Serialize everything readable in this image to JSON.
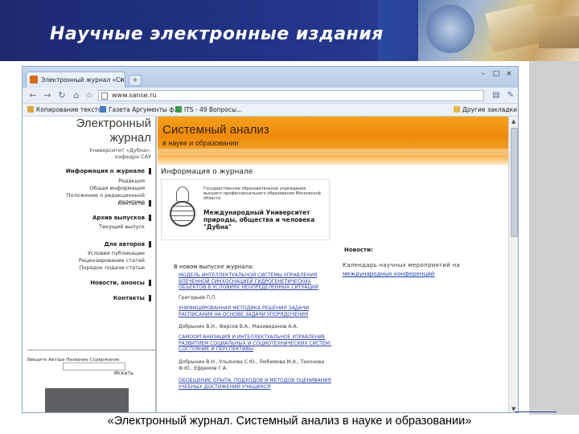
{
  "slide": {
    "title": "Научные электронные издания",
    "caption": "«Электронный журнал. Системный анализ в науке и образовании»"
  },
  "browser": {
    "tab_title": "Электронный журнал «Си...",
    "new_tab_label": "+",
    "window_buttons": [
      "–",
      "□",
      "×"
    ],
    "url": "www.sanse.ru",
    "nav": {
      "back": "←",
      "forward": "→",
      "reload": "↻"
    },
    "bookmarks": [
      {
        "label": "Копирование текстов",
        "color": "#d9a441"
      },
      {
        "label": "Газета Аргументы ф...",
        "color": "#4a79c4"
      },
      {
        "label": "ITS - 49 Вопросы...",
        "color": "#3a9a4a"
      }
    ],
    "other_bookmarks": "Другие закладки"
  },
  "page": {
    "logo_line1": "Электронный",
    "logo_line2": "журнал",
    "logo_sub": "Университет «Дубна», кафедра САУ",
    "banner_title": "Системный анализ",
    "banner_sub": "в науке и образовании",
    "sidebar": {
      "info_head": "Информация о журнале",
      "info_links": [
        "Редакция",
        "Общая информация",
        "Положение о редакционной политике",
        "Контакты"
      ],
      "archive_head": "Архив выпусков",
      "archive_links": [
        "Текущий выпуск"
      ],
      "authors_head": "Для авторов",
      "authors_links": [
        "Условия публикации",
        "Рецензирование статей",
        "Порядок подачи статьи"
      ],
      "news_head": "Новости, анонсы",
      "contacts_head": "Контакты"
    },
    "info_section_title": "Информация о журнале",
    "university_small": "Государственное образовательное учреждение высшего профессионального образования Московской области",
    "university_name": "Международный Университет природы, общества и человека \"Дубна\"",
    "news_head": "Новости:",
    "news_text": "Календарь научных мероприятий на",
    "news_link": "международных конференций",
    "issue_head": "В новом выпуске журнала:",
    "articles": [
      {
        "text": "МОДЕЛЬ ИНТЕЛЛЕКТУАЛЬНОЙ СИСТЕМЫ УПРАВЛЕНИЯ ВЛЕЧЕННОЙ СИНХОСНАЦИЕЙ ГИДРОГЕНЕТИЧЕСКИХ ОБЪЕКТОВ В УСЛОВИЯХ НЕОПРЕДЕЛЕННЫХ СИТУАЦИЙ",
        "link": true
      },
      {
        "text": "Григорьев П.П.",
        "link": false
      },
      {
        "text": "УНИФИЦИРОВАННАЯ МЕТОДИКА РЕШЕНИЯ ЗАДАЧИ РАСПИСАНИЯ НА ОСНОВЕ ЗАДАЧИ УПОРЯДОЧЕНИЯ",
        "link": true
      },
      {
        "text": "Добрынин В.Н., Фирсов В.А., Маниведенов А.А.",
        "link": false
      },
      {
        "text": "САМООРГАНИЗАЦИЯ И ИНТЕЛЛЕКТУАЛЬНОЕ УПРАВЛЕНИЕ РАЗВИТИЕМ СОЦИАЛЬНЫХ И СОЦИОТЕХНИЧЕСКИХ СИСТЕМ: СОСТОЯНИЕ И ПЕРСПЕКТИВЫ",
        "link": true
      },
      {
        "text": "Добрынин В.Н., Ульянова С.Ю., Любимова М.А., Тихонова Ф.Ю., Ефремов Г.А.",
        "link": false
      },
      {
        "text": "ОБОБЩЕНИЕ ОПЫТА, ПОДХОДОВ И МЕТОДОВ ОЦЕНИВАНИЯ УЧЕБНЫХ ДОСТИЖЕНИЙ УЧАЩИХСЯ",
        "link": true
      }
    ],
    "search_label": "Введите Автора Название Содержание",
    "search_button": "Искать"
  }
}
